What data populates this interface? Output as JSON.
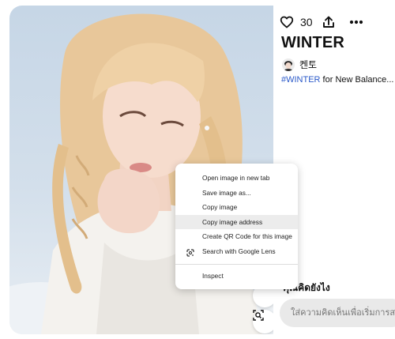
{
  "post": {
    "title": "WINTER",
    "like_count": "30",
    "author": "켄토",
    "hashtag": "#WINTER",
    "description_rest": " for New Balance..."
  },
  "comments": {
    "heading": "คุณคิดยังไง",
    "placeholder": "ใส่ความคิดเห็นเพื่อเริ่มการสนทนา"
  },
  "context_menu": {
    "items": [
      "Open image in new tab",
      "Save image as...",
      "Copy image",
      "Copy image address",
      "Create QR Code for this image",
      "Search with Google Lens",
      "Inspect"
    ],
    "hovered_item": "Copy image address"
  },
  "icons": {
    "like": "heart-icon",
    "share": "share-upload-icon",
    "more": "more-dots-icon",
    "lens": "google-lens-icon",
    "visual_search": "visual-search-icon"
  },
  "colors": {
    "hashtag": "#2a59c9",
    "photo_sky": "#c6d6e6",
    "menu_hover": "#ececec",
    "comment_box": "#e9e9e9"
  }
}
